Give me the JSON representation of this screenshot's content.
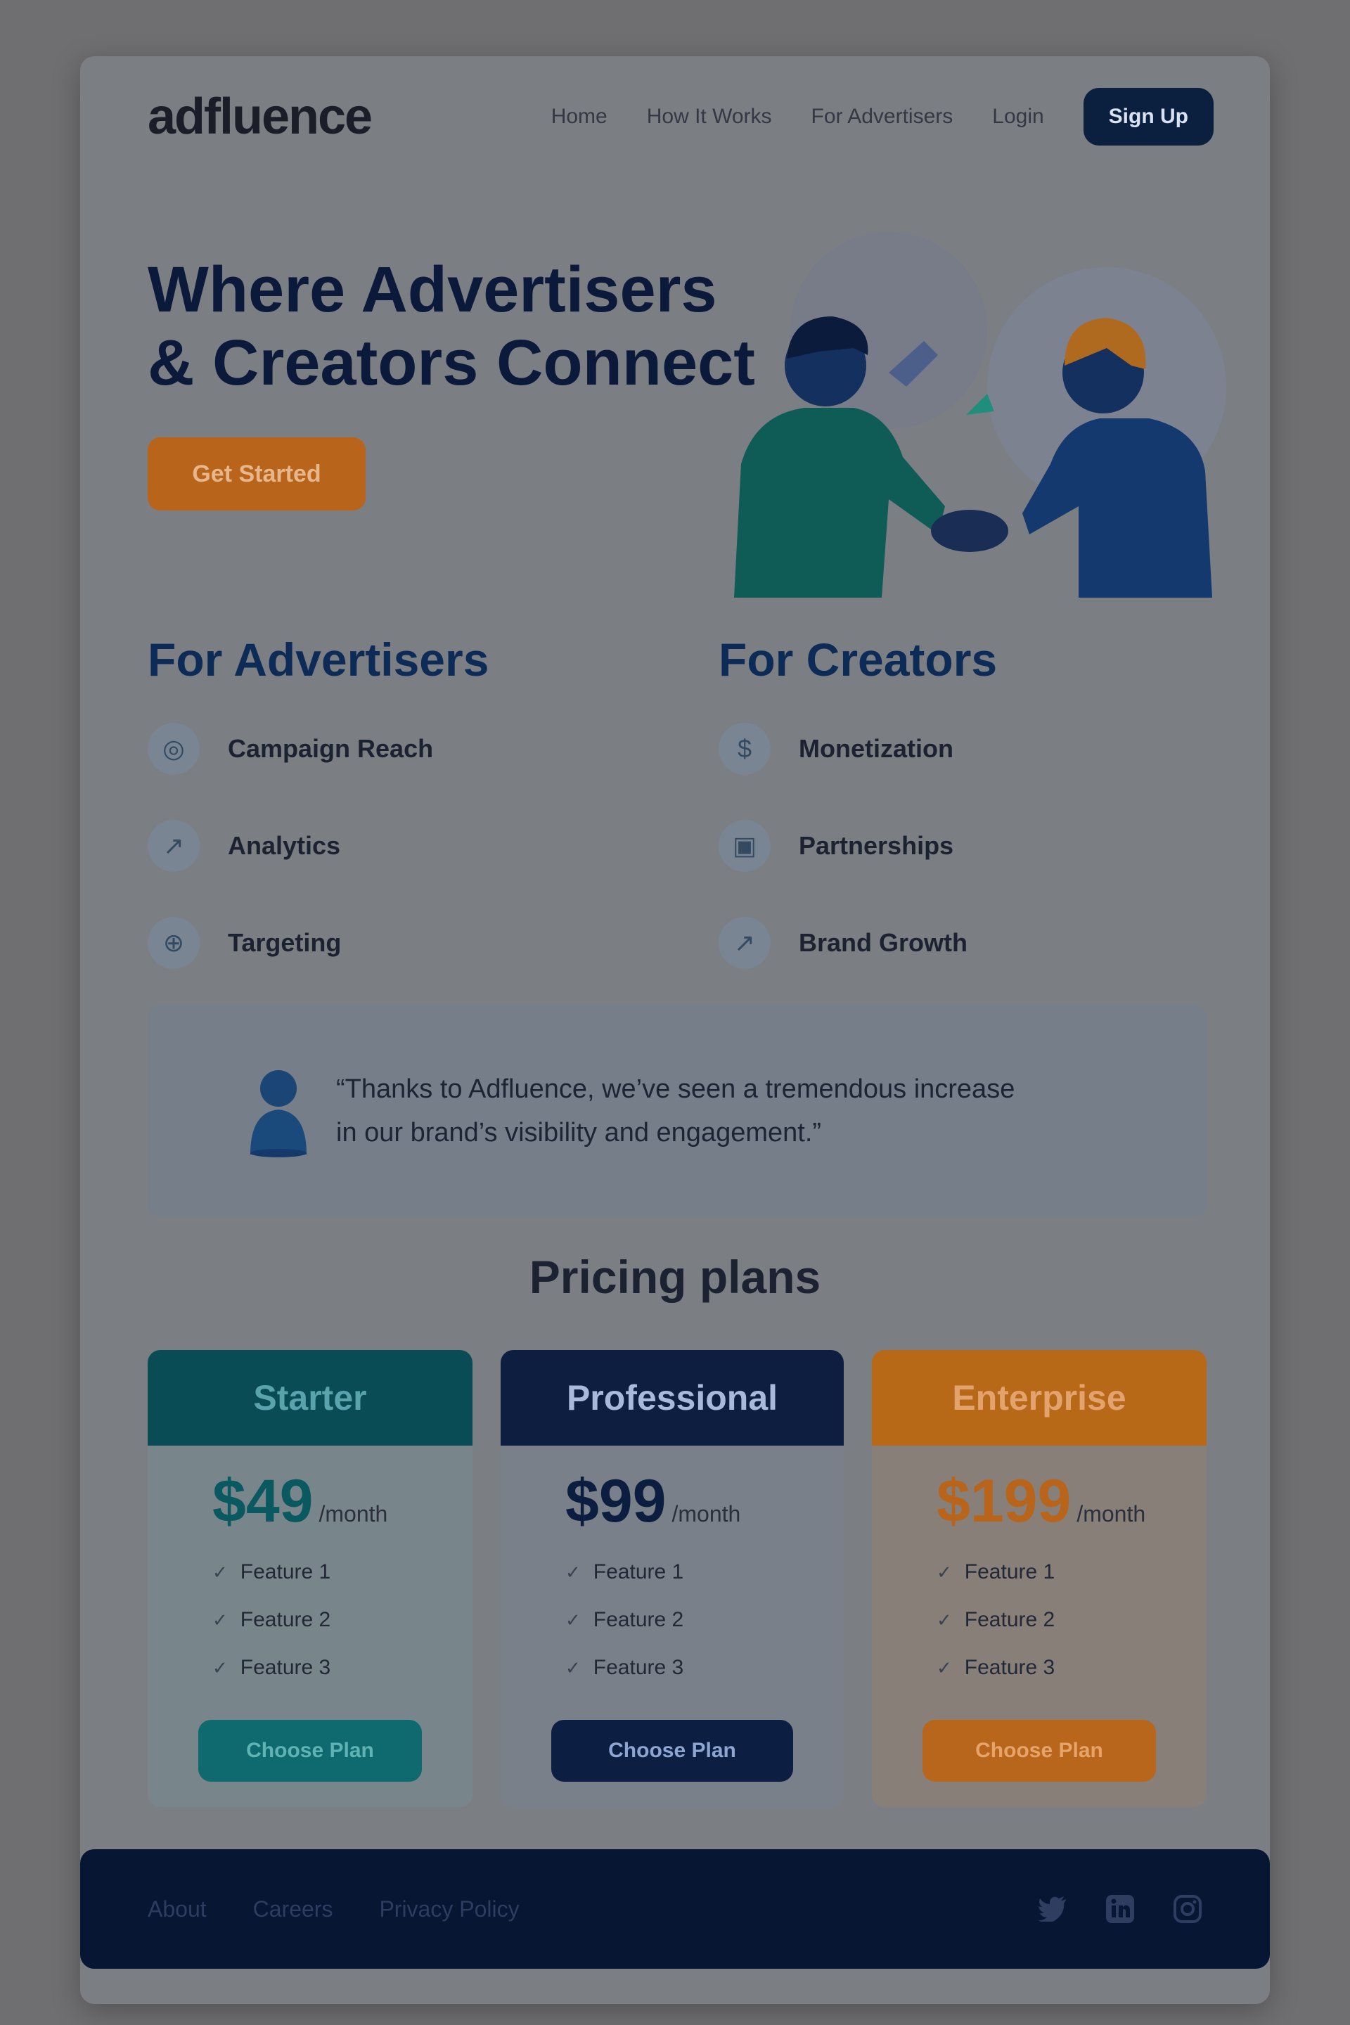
{
  "header": {
    "logo": "adfluence",
    "nav": [
      "Home",
      "How It Works",
      "For Advertisers",
      "Login"
    ],
    "signup": "Sign Up"
  },
  "hero": {
    "title_line1": "Where Advertisers",
    "title_line2": "& Creators Connect",
    "cta": "Get Started"
  },
  "advertisers": {
    "title": "For Advertisers",
    "features": [
      {
        "icon": "target-icon",
        "label": "Campaign Reach"
      },
      {
        "icon": "analytics-icon",
        "label": "Analytics"
      },
      {
        "icon": "crosshair-icon",
        "label": "Targeting"
      }
    ]
  },
  "creators": {
    "title": "For Creators",
    "features": [
      {
        "icon": "dollar-icon",
        "label": "Monetization"
      },
      {
        "icon": "handshake-icon",
        "label": "Partnerships"
      },
      {
        "icon": "growth-icon",
        "label": "Brand Growth"
      }
    ]
  },
  "testimonial": {
    "quote_line1": "“Thanks to Adfluence, we’ve seen a tremendous increase",
    "quote_line2": "in our brand’s visibility and engagement.”"
  },
  "pricing": {
    "title": "Pricing plans",
    "plans": [
      {
        "name": "Starter",
        "price": "$49",
        "period": "/month",
        "features": [
          "Feature 1",
          "Feature 2",
          "Feature 3"
        ],
        "button": "Choose Plan"
      },
      {
        "name": "Professional",
        "price": "$99",
        "period": "/month",
        "features": [
          "Feature 1",
          "Feature 2",
          "Feature 3"
        ],
        "button": "Choose Plan"
      },
      {
        "name": "Enterprise",
        "price": "$199",
        "period": "/month",
        "features": [
          "Feature 1",
          "Feature 2",
          "Feature 3"
        ],
        "button": "Choose Plan"
      }
    ]
  },
  "footer": {
    "links": [
      "About",
      "Careers",
      "Privacy Policy"
    ],
    "socials": [
      "twitter-icon",
      "linkedin-icon",
      "instagram-icon"
    ]
  },
  "colors": {
    "navy": "#0b1f3f",
    "teal": "#0a4c55",
    "orange": "#b8641a"
  }
}
